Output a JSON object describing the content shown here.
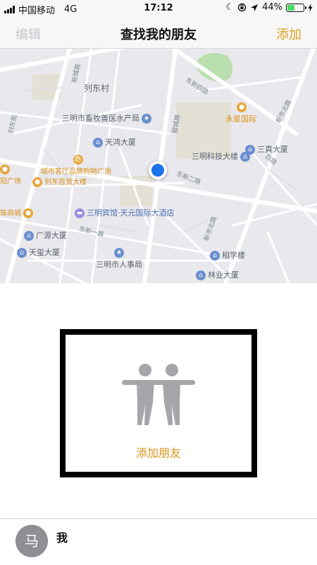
{
  "status_bar": {
    "carrier": "中国移动",
    "network": "4G",
    "time": "17:12",
    "battery_percent": "44%",
    "battery_level": 0.44,
    "icons": [
      "signal-icon",
      "moon-icon",
      "lock-rotation-icon",
      "location-arrow-icon",
      "battery-icon",
      "charging-icon"
    ]
  },
  "nav": {
    "left_label": "编辑",
    "title": "查找我的朋友",
    "right_label": "添加"
  },
  "map": {
    "labels": {
      "village": "列东村",
      "bureau": "三明市畜牧兽医水产局",
      "yongxing": "永星国际",
      "tianhong": "天鸿大厦",
      "mall": "城市客厅品牌购物广场",
      "keji": "三明科技大楼",
      "sanzhen": "三真大厦",
      "plaza": "阳广场",
      "baihuo": "列东百货大楼",
      "zhushang": "珠商城",
      "hotel": "三明宾馆·天元国际大酒店",
      "guangyuan": "广源大厦",
      "tianxi": "天玺大厦",
      "renshi": "三明市人事局",
      "xiangxue": "相学楼",
      "linye": "林业大厦"
    },
    "roads": {
      "dongxin4": "东新四路",
      "dongxin1": "东新一路",
      "dongxin2": "东新二路",
      "xinbei": "新市北路",
      "xinshi": "新市北路",
      "xincheng": "新城路",
      "liedong": "列东街",
      "bailu": "白路",
      "yuncheng": "碧城路",
      "xijie": "东一路"
    }
  },
  "add_friend": {
    "label": "添加朋友",
    "icon": "friends-icon"
  },
  "me": {
    "avatar_text": "马",
    "label": "我"
  },
  "colors": {
    "accent": "#e0a21a",
    "user_location": "#1a73e8",
    "map_background": "#e9e8ec"
  }
}
